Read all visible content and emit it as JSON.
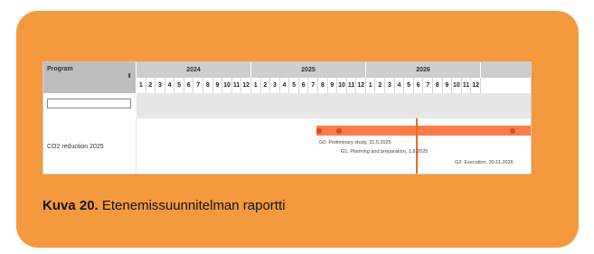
{
  "gantt": {
    "column_header": "Program",
    "sort_icon": "⬍",
    "years": [
      "2024",
      "2025",
      "2026"
    ],
    "months": [
      "1",
      "2",
      "3",
      "4",
      "5",
      "6",
      "7",
      "8",
      "9",
      "10",
      "11",
      "12"
    ],
    "filter_value": "",
    "rows": [
      {
        "label": "CO2 reduction 2025",
        "milestones": [
          "G0: Preliminary study, 31.5.2025",
          "G1: Planning and preparation, 1.8.2025",
          "G2: Execution, 30.11.2026"
        ]
      }
    ],
    "bar_color": "#ff7a4a",
    "today_line_color": "#f06a1b"
  },
  "caption": {
    "bold": "Kuva 20.",
    "text": " Etenemissuunnitelman raportti"
  },
  "colors": {
    "card": "#f4993e"
  }
}
